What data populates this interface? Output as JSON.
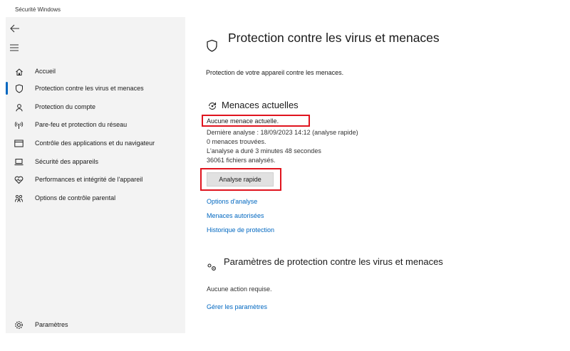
{
  "window": {
    "title": "Sécurité Windows"
  },
  "sidebar": {
    "items": [
      {
        "label": "Accueil",
        "icon": "home-icon"
      },
      {
        "label": "Protection contre les virus et menaces",
        "icon": "shield-icon"
      },
      {
        "label": "Protection du compte",
        "icon": "person-icon"
      },
      {
        "label": "Pare-feu et protection du réseau",
        "icon": "wifi-antenna-icon"
      },
      {
        "label": "Contrôle des applications et du navigateur",
        "icon": "browser-window-icon"
      },
      {
        "label": "Sécurité des appareils",
        "icon": "laptop-icon"
      },
      {
        "label": "Performances et intégrité de l'appareil",
        "icon": "heart-icon"
      },
      {
        "label": "Options de contrôle parental",
        "icon": "family-icon"
      }
    ],
    "settings_label": "Paramètres"
  },
  "main": {
    "title": "Protection contre les virus et menaces",
    "subtitle": "Protection de votre appareil contre les menaces.",
    "current_threats": {
      "heading": "Menaces actuelles",
      "status": "Aucune menace actuelle.",
      "last_scan": "Dernière analyse : 18/09/2023 14:12 (analyse rapide)",
      "threats_found": "0 menaces trouvées.",
      "duration": "L'analyse a duré 3 minutes 48 secondes",
      "files_scanned": "36061 fichiers analysés.",
      "quick_scan_button": "Analyse rapide",
      "links": [
        "Options d'analyse",
        "Menaces autorisées",
        "Historique de protection"
      ]
    },
    "settings_section": {
      "heading": "Paramètres de protection contre les virus et menaces",
      "status": "Aucune action requise.",
      "manage_link": "Gérer les paramètres"
    }
  },
  "colors": {
    "accent": "#0067c0",
    "highlight": "#e0141e",
    "sidebar_bg": "#f3f3f3"
  }
}
